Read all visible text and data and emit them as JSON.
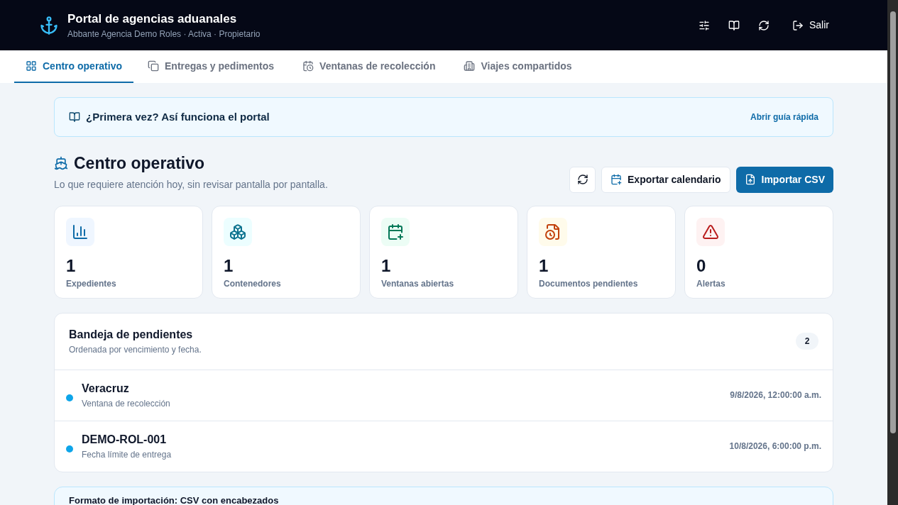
{
  "header": {
    "title": "Portal de agencias aduanales",
    "subtitle": "Abbante Agencia Demo Roles · Activa · Propietario",
    "logout": "Salir"
  },
  "tabs": [
    {
      "label": "Centro operativo",
      "selected": true,
      "kind": "grid"
    },
    {
      "label": "Entregas y pedimentos",
      "selected": false,
      "kind": "copies"
    },
    {
      "label": "Ventanas de recolección",
      "selected": false,
      "kind": "calendar"
    },
    {
      "label": "Viajes compartidos",
      "selected": false,
      "kind": "building"
    }
  ],
  "guide_banner": {
    "title": "¿Primera vez? Así funciona el portal",
    "link": "Abrir guía rápida"
  },
  "page": {
    "title": "Centro operativo",
    "subtitle": "Lo que requiere atención hoy, sin revisar pantalla por pantalla.",
    "export_button": "Exportar calendario",
    "import_button": "Importar CSV"
  },
  "stats": [
    {
      "value": "1",
      "label": "Expedientes",
      "kind": "chart"
    },
    {
      "value": "1",
      "label": "Contenedores",
      "kind": "boxes"
    },
    {
      "value": "1",
      "label": "Ventanas abiertas",
      "kind": "calendar"
    },
    {
      "value": "1",
      "label": "Documentos pendientes",
      "kind": "document"
    },
    {
      "value": "0",
      "label": "Alertas",
      "kind": "alert"
    }
  ],
  "inbox": {
    "title": "Bandeja de pendientes",
    "subtitle": "Ordenada por vencimiento y fecha.",
    "count": "2",
    "items": [
      {
        "title": "Veracruz",
        "subtitle": "Ventana de recolección",
        "date": "9/8/2026, 12:00:00 a.m."
      },
      {
        "title": "DEMO-ROL-001",
        "subtitle": "Fecha límite de entrega",
        "date": "10/8/2026, 6:00:00 p.m."
      }
    ]
  },
  "import_format": {
    "title": "Formato de importación: CSV con encabezados"
  }
}
